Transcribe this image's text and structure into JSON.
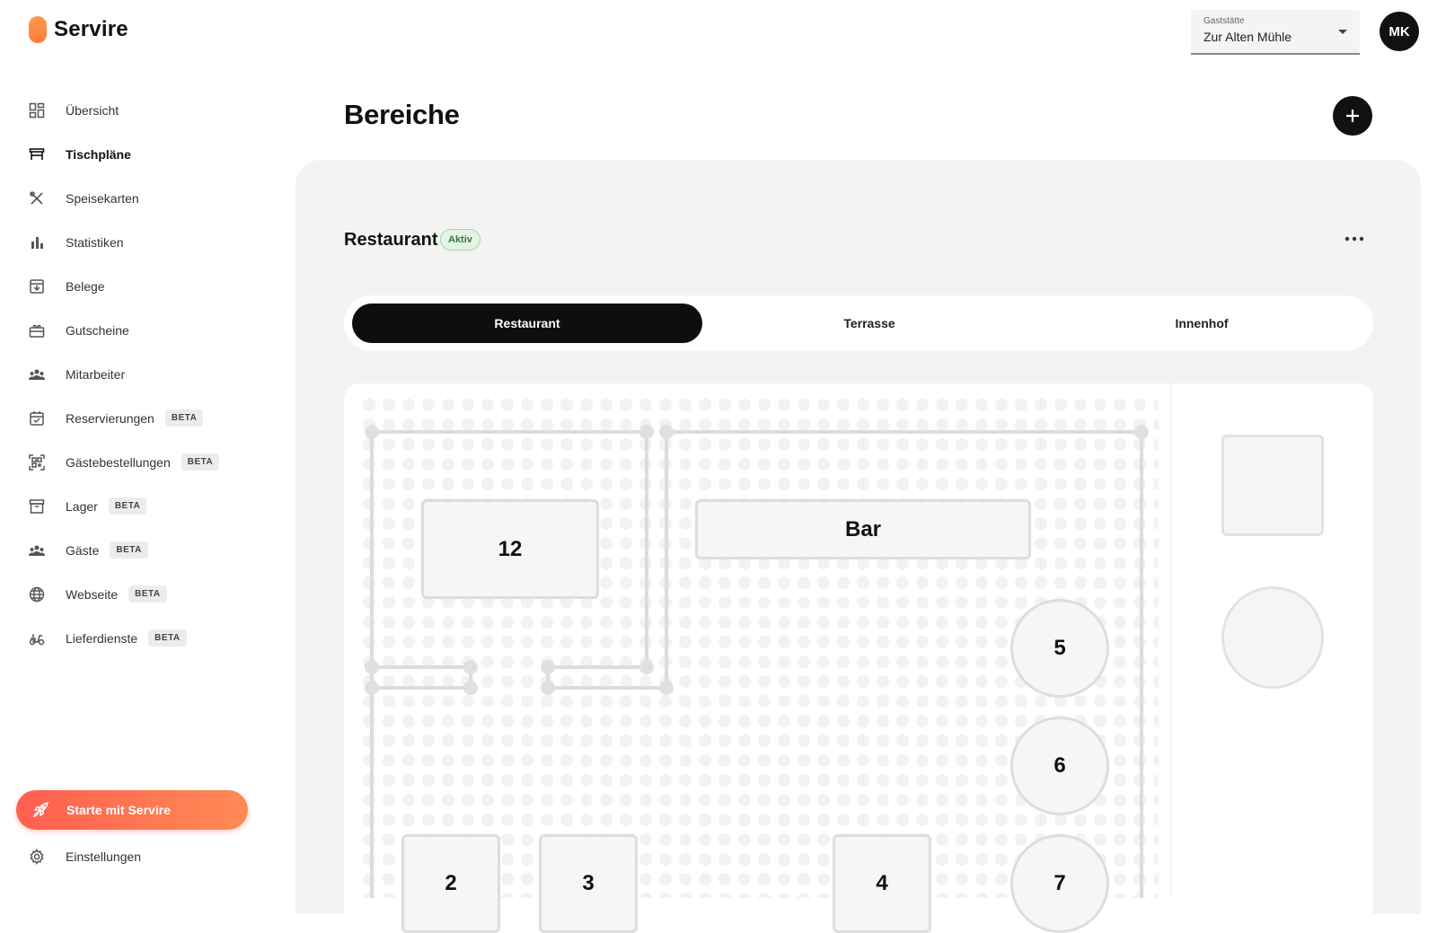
{
  "app": {
    "name": "Servire"
  },
  "sidebar": {
    "items": [
      {
        "label": "Übersicht",
        "icon": "dashboard-icon",
        "beta": ""
      },
      {
        "label": "Tischpläne",
        "icon": "table-icon",
        "beta": "",
        "active": true
      },
      {
        "label": "Speisekarten",
        "icon": "cutlery-icon",
        "beta": ""
      },
      {
        "label": "Statistiken",
        "icon": "bar-chart-icon",
        "beta": ""
      },
      {
        "label": "Belege",
        "icon": "receipt-icon",
        "beta": ""
      },
      {
        "label": "Gutscheine",
        "icon": "gift-card-icon",
        "beta": ""
      },
      {
        "label": "Mitarbeiter",
        "icon": "people-icon",
        "beta": ""
      },
      {
        "label": "Reservierungen",
        "icon": "calendar-check-icon",
        "beta": "BETA"
      },
      {
        "label": "Gästebestellungen",
        "icon": "qr-code-icon",
        "beta": "BETA"
      },
      {
        "label": "Lager",
        "icon": "archive-box-icon",
        "beta": "BETA"
      },
      {
        "label": "Gäste",
        "icon": "guests-icon",
        "beta": "BETA"
      },
      {
        "label": "Webseite",
        "icon": "globe-icon",
        "beta": "BETA"
      },
      {
        "label": "Lieferdienste",
        "icon": "scooter-icon",
        "beta": "BETA"
      }
    ],
    "cta": {
      "label": "Starte mit Servire",
      "icon": "rocket-icon"
    },
    "settings": {
      "label": "Einstellungen",
      "icon": "gear-icon"
    }
  },
  "topbar": {
    "venue": {
      "caption": "Gaststätte",
      "value": "Zur Alten Mühle"
    },
    "avatar": "MK"
  },
  "main": {
    "title": "Bereiche",
    "add_icon": "plus-icon",
    "area": {
      "name": "Restaurant",
      "status": "Aktiv",
      "more_icon": "more-horizontal-icon"
    },
    "tabs": [
      {
        "label": "Restaurant",
        "active": true
      },
      {
        "label": "Terrasse",
        "active": false
      },
      {
        "label": "Innenhof",
        "active": false
      }
    ],
    "floorplan": {
      "tables": [
        {
          "label": "12",
          "shape": "rect"
        },
        {
          "label": "Bar",
          "shape": "rect"
        },
        {
          "label": "5",
          "shape": "round"
        },
        {
          "label": "6",
          "shape": "round"
        },
        {
          "label": "2",
          "shape": "rect"
        },
        {
          "label": "3",
          "shape": "rect"
        },
        {
          "label": "4",
          "shape": "rect"
        },
        {
          "label": "7",
          "shape": "round"
        }
      ]
    },
    "palette": [
      {
        "shape": "square"
      },
      {
        "shape": "round"
      }
    ]
  }
}
